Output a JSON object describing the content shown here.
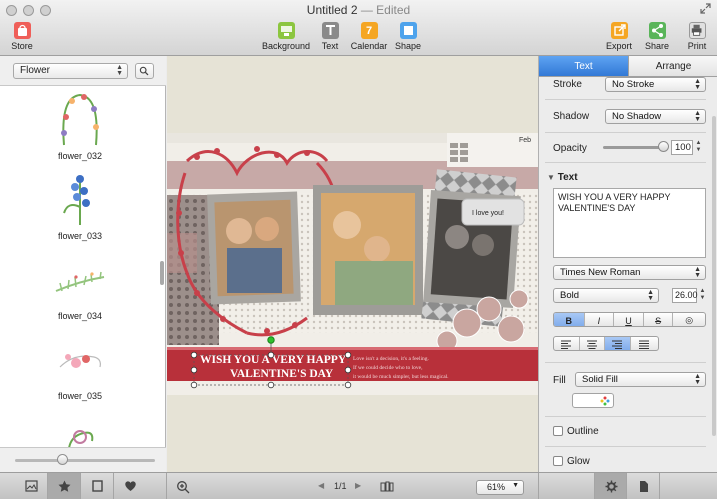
{
  "window": {
    "title": "Untitled 2",
    "status": "— Edited"
  },
  "toolbar": {
    "store": "Store",
    "background": "Background",
    "text": "Text",
    "calendar": "Calendar",
    "calendar_day": "7",
    "shape": "Shape",
    "export": "Export",
    "share": "Share",
    "print": "Print"
  },
  "left_panel": {
    "category": "Flower",
    "items": [
      {
        "label": "flower_032"
      },
      {
        "label": "flower_033"
      },
      {
        "label": "flower_034"
      },
      {
        "label": "flower_035"
      }
    ]
  },
  "card": {
    "month": "Feb",
    "bubble": "I love you!",
    "headline_line1": "WISH YOU A VERY HAPPY",
    "headline_line2": "VALENTINE'S DAY",
    "body_text_1": "Love isn't a decision, it's a feeling.",
    "body_text_2": "If we could decide who to love,",
    "body_text_3": "it would be much simpler, but less magical."
  },
  "bottom": {
    "page": "1/1",
    "zoom": "61%"
  },
  "inspector": {
    "tab_text": "Text",
    "tab_arrange": "Arrange",
    "stroke_label": "Stroke",
    "stroke_value": "No Stroke",
    "shadow_label": "Shadow",
    "shadow_value": "No Shadow",
    "opacity_label": "Opacity",
    "opacity_value": "100",
    "opacity_level": 1.0,
    "section_text": "Text",
    "text_content": "WISH YOU A VERY HAPPY VALENTINE'S DAY",
    "font_family": "Times New Roman",
    "font_style": "Bold",
    "font_size": "26.00",
    "style_buttons": [
      "B",
      "I",
      "U",
      "S",
      "◎"
    ],
    "fill_label": "Fill",
    "fill_value": "Solid Fill",
    "outline_label": "Outline",
    "glow_label": "Glow"
  },
  "colors": {
    "accent": "#3279d6",
    "banner": "#b8303a",
    "hearts": "#c8404a"
  }
}
